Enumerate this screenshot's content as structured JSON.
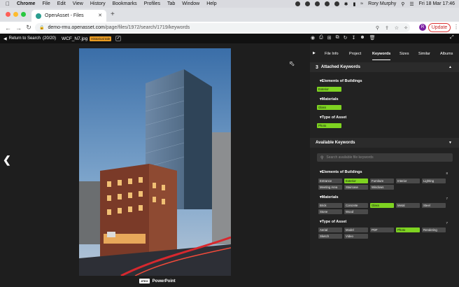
{
  "macos": {
    "menus": [
      "Chrome",
      "File",
      "Edit",
      "View",
      "History",
      "Bookmarks",
      "Profiles",
      "Tab",
      "Window",
      "Help"
    ],
    "user": "Rory Murphy",
    "clock": "Fri 18 Mar  17:46"
  },
  "browser": {
    "tab_title": "OpenAsset - Files",
    "url_host": "demo-rmu.openasset.com",
    "url_path": "/page/files/1972/search/1719/keywords",
    "profile_initial": "R",
    "update_label": "Update"
  },
  "appbar": {
    "back_label": "Return to Search",
    "back_count": "(20/20)",
    "filename": "WCF_N7.jpg",
    "badge": "Historical tale"
  },
  "viewer": {
    "format": "JPEG",
    "caption": "PowerPoint"
  },
  "panel": {
    "tabs": [
      "File Info",
      "Project",
      "Keywords",
      "Sizes",
      "Similar",
      "Albums"
    ],
    "active_tab": "Keywords",
    "attached": {
      "count": "3",
      "title": "Attached Keywords",
      "groups": [
        {
          "name": "Elements of Buildings",
          "keywords": [
            "Exterior"
          ]
        },
        {
          "name": "Materials",
          "keywords": [
            "Glass"
          ]
        },
        {
          "name": "Type of Asset",
          "keywords": [
            "Photo"
          ]
        }
      ]
    },
    "available": {
      "title": "Available Keywords",
      "search_placeholder": "Search available file keywords",
      "groups": [
        {
          "name": "Elements of Buildings",
          "count": "8",
          "keywords": [
            "Entrance",
            "Exterior",
            "Furniture",
            "Interior",
            "Lighting",
            "Meeting Area",
            "Staircase",
            "Windows"
          ],
          "selected": [
            "Exterior"
          ]
        },
        {
          "name": "Materials",
          "count": "7",
          "keywords": [
            "Brick",
            "Concrete",
            "Glass",
            "Metal",
            "Steel",
            "Stone",
            "Wood"
          ],
          "selected": [
            "Glass"
          ]
        },
        {
          "name": "Type of Asset",
          "count": "7",
          "keywords": [
            "Aerial",
            "Model",
            "PDF",
            "Photo",
            "Rendering",
            "Sketch",
            "Video"
          ],
          "selected": [
            "Photo"
          ]
        }
      ]
    }
  },
  "colors": {
    "selected_keyword": "#7ed321",
    "panel_bg": "#222222",
    "update": "#c62828"
  }
}
